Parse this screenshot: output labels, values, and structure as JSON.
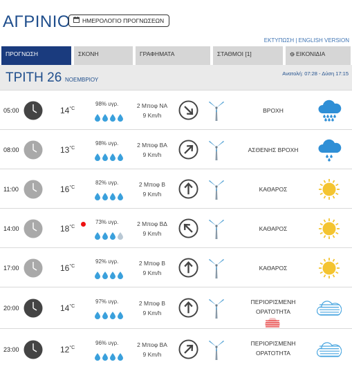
{
  "header": {
    "city": "ΑΓΡΙΝΙΟ",
    "calendar_label": "ΗΜΕΡΟΛΟΓΙΟ ΠΡΟΓΝΩΣΕΩΝ",
    "links": "ΕΚΤΥΠΩΣΗ | ENGLISH VERSION"
  },
  "tabs": [
    {
      "label": "ΠΡΟΓΝΩΣΗ",
      "active": true
    },
    {
      "label": "ΣΚΟΝΗ",
      "active": false
    },
    {
      "label": "ΓΡΑΦΗΜΑΤΑ",
      "active": false
    },
    {
      "label": "ΣΤΑΘΜΟΙ [1]",
      "active": false
    },
    {
      "label": "ΕΙΚΟΝΙΔΙΑ",
      "active": false
    }
  ],
  "day": {
    "name": "ΤΡΙΤΗ 26",
    "month": "ΝΟΕΜΒΡΙΟΥ",
    "sun": "Ανατολή: 07:28 - Δύση 17:15"
  },
  "colors": {
    "brand": "#1a3b7e",
    "title": "#1f4e8c",
    "drop": "#3aa0dc",
    "rain_cloud": "#2f8fd6",
    "sun": "#f4c430",
    "haze": "#4aa6e0",
    "warning": "#e11111"
  },
  "rows": [
    {
      "time": "05:00",
      "clock_style": "dark",
      "temp": "14",
      "unit": "°C",
      "red_dot": false,
      "humidity": "98% υγρ.",
      "drops_full": 4,
      "wind_force": "2 Μποφ ΝΑ",
      "wind_speed": "9 Km/h",
      "wind_direction_deg": 315,
      "condition": "ΒΡΟΧΗ",
      "icon": "heavy-rain-icon"
    },
    {
      "time": "08:00",
      "clock_style": "light",
      "temp": "13",
      "unit": "°C",
      "red_dot": false,
      "humidity": "98% υγρ.",
      "drops_full": 4,
      "wind_force": "2 Μποφ ΒΑ",
      "wind_speed": "9 Km/h",
      "wind_direction_deg": 225,
      "condition": "ΑΣΘΕΝΗΣ ΒΡΟΧΗ",
      "icon": "light-rain-icon"
    },
    {
      "time": "11:00",
      "clock_style": "light",
      "temp": "16",
      "unit": "°C",
      "red_dot": false,
      "humidity": "82% υγρ.",
      "drops_full": 4,
      "wind_force": "2 Μποφ Β",
      "wind_speed": "9 Km/h",
      "wind_direction_deg": 180,
      "condition": "ΚΑΘΑΡΟΣ",
      "icon": "sun-icon"
    },
    {
      "time": "14:00",
      "clock_style": "light",
      "temp": "18",
      "unit": "°C",
      "red_dot": true,
      "humidity": "73% υγρ.",
      "drops_full": 3,
      "wind_force": "2 Μποφ ΒΔ",
      "wind_speed": "9 Km/h",
      "wind_direction_deg": 135,
      "condition": "ΚΑΘΑΡΟΣ",
      "icon": "sun-icon"
    },
    {
      "time": "17:00",
      "clock_style": "light",
      "temp": "16",
      "unit": "°C",
      "red_dot": false,
      "humidity": "92% υγρ.",
      "drops_full": 4,
      "wind_force": "2 Μποφ Β",
      "wind_speed": "9 Km/h",
      "wind_direction_deg": 180,
      "condition": "ΚΑΘΑΡΟΣ",
      "icon": "sun-icon"
    },
    {
      "time": "20:00",
      "clock_style": "dark",
      "temp": "14",
      "unit": "°C",
      "red_dot": false,
      "humidity": "97% υγρ.",
      "drops_full": 4,
      "wind_force": "2 Μποφ Β",
      "wind_speed": "9 Km/h",
      "wind_direction_deg": 180,
      "condition": "ΠΕΡΙΟΡΙΣΜΕΝΗ ΟΡΑΤΟΤΗΤΑ",
      "haze_warning": true,
      "icon": "fog-icon"
    },
    {
      "time": "23:00",
      "clock_style": "dark",
      "temp": "12",
      "unit": "°C",
      "red_dot": false,
      "humidity": "96% υγρ.",
      "drops_full": 4,
      "wind_force": "2 Μποφ ΒΑ",
      "wind_speed": "9 Km/h",
      "wind_direction_deg": 225,
      "condition": "ΠΕΡΙΟΡΙΣΜΕΝΗ ΟΡΑΤΟΤΗΤΑ",
      "haze_warning": false,
      "icon": "fog-icon"
    }
  ]
}
